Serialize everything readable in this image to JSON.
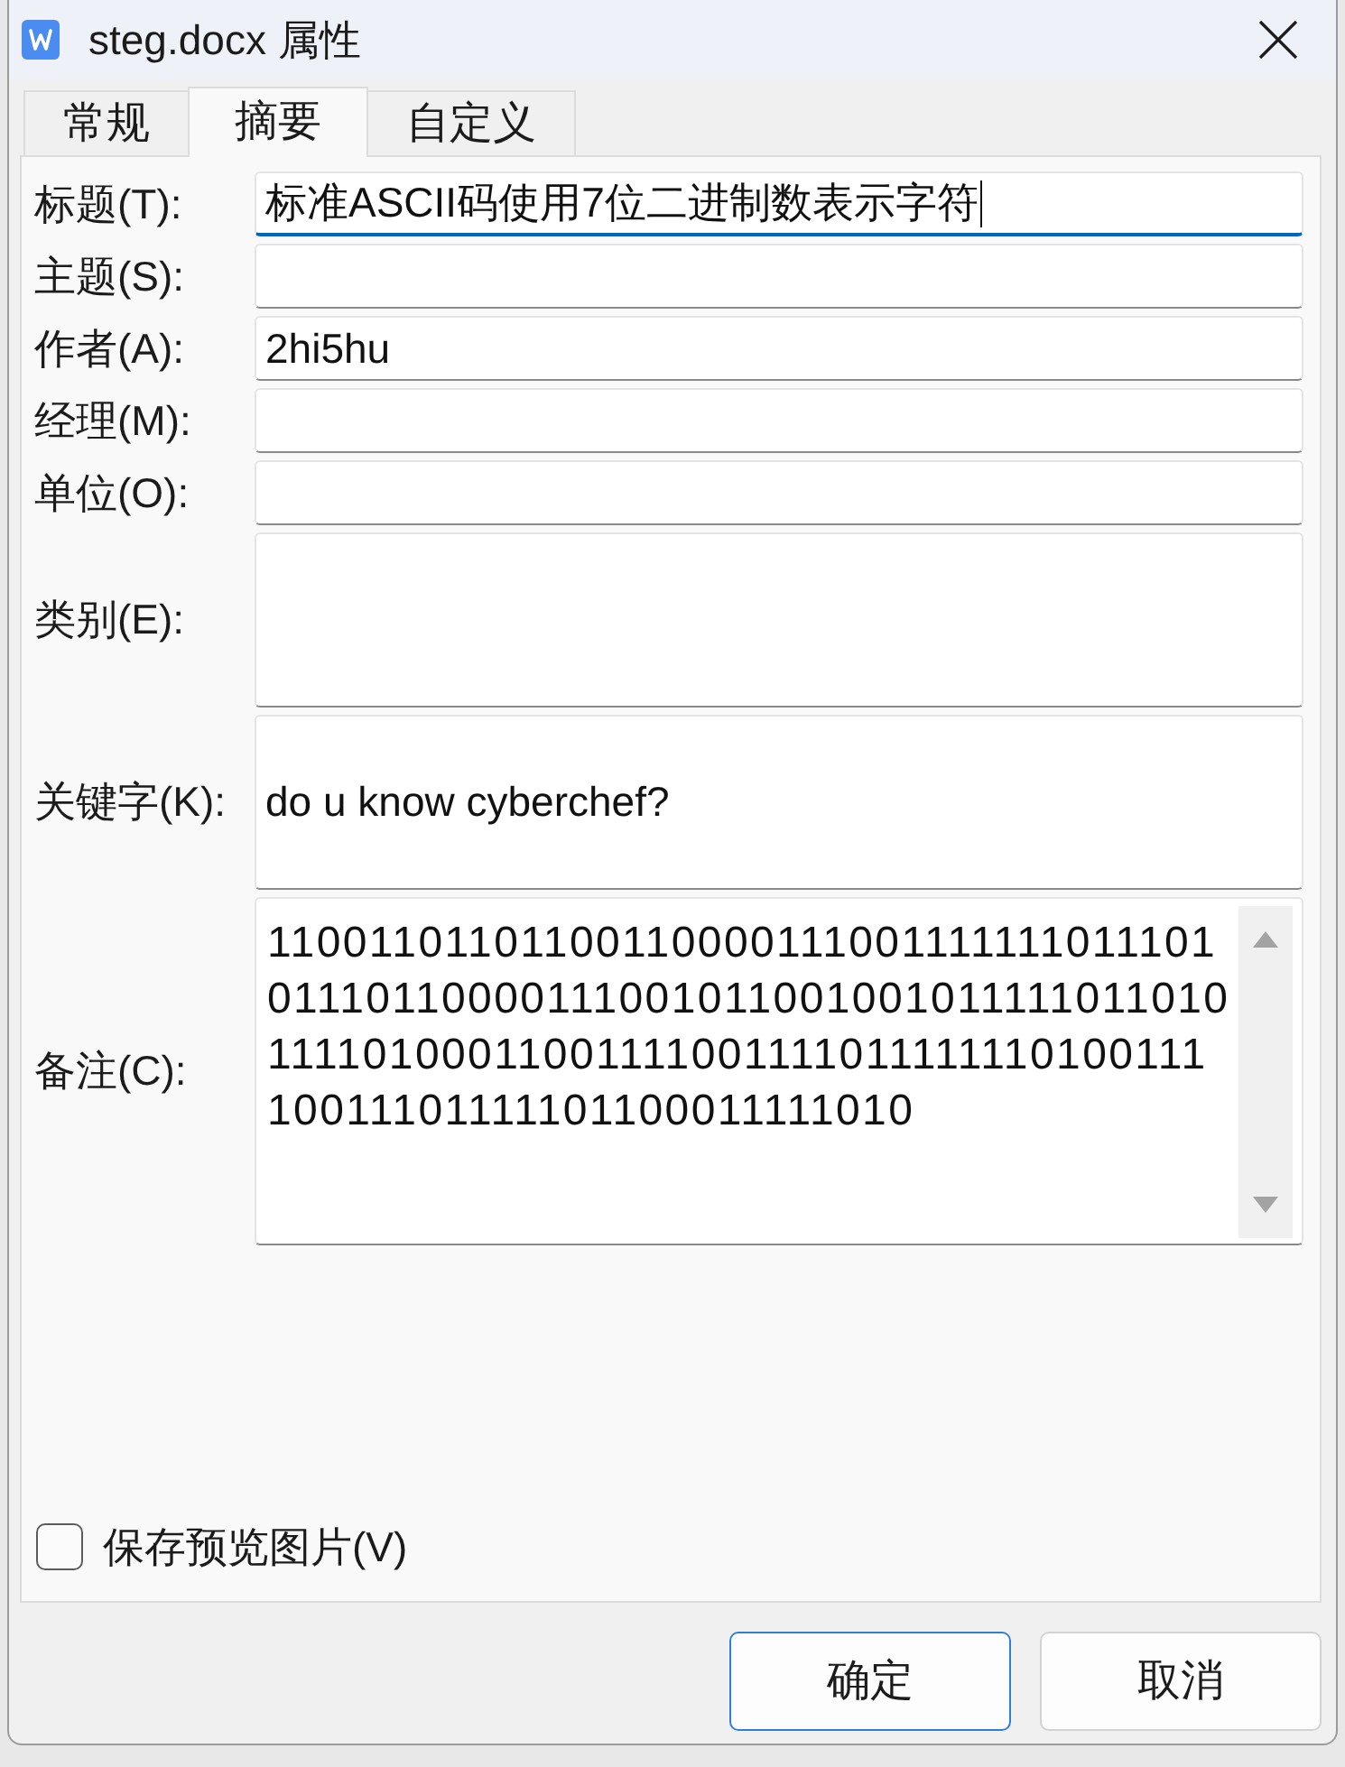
{
  "window": {
    "title": "steg.docx 属性"
  },
  "tabs": [
    {
      "label": "常规",
      "selected": false
    },
    {
      "label": "摘要",
      "selected": true
    },
    {
      "label": "自定义",
      "selected": false
    }
  ],
  "fields": [
    {
      "kind": "line",
      "label": "标题(T):",
      "value": "标准ASCII码使用7位二进制数表示字符",
      "focused": true
    },
    {
      "kind": "line",
      "label": "主题(S):",
      "focused": false
    },
    {
      "kind": "line",
      "label": "作者(A):",
      "value": "2hi5hu",
      "focused": false
    },
    {
      "kind": "line",
      "label": "经理(M):",
      "focused": false
    },
    {
      "kind": "line",
      "label": "单位(O):",
      "focused": false
    },
    {
      "kind": "tall",
      "label": "类别(E):",
      "focused": false
    },
    {
      "kind": "tall",
      "label": "关键字(K):",
      "value": "do u know cyberchef?",
      "focused": false
    },
    {
      "kind": "scroll",
      "label": "备注(C):",
      "value": "11001101101100110000111001111111011101011101100001110010110010010111110110101111010001100111100111101111111010011110011101111101100011111010",
      "focused": false
    }
  ],
  "save_preview": {
    "label": "保存预览图片(V)",
    "checked": false
  },
  "buttons": [
    {
      "label": "确定",
      "default": true
    },
    {
      "label": "取消",
      "default": false
    }
  ]
}
